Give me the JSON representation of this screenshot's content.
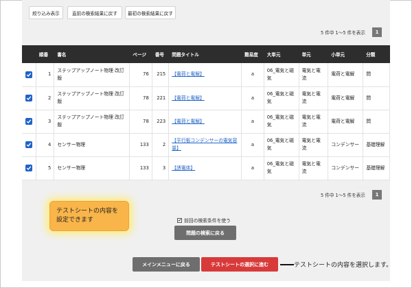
{
  "toolbar": {
    "filter_label": "絞り込み表示",
    "prev_result_label": "直前の検索結果に戻す",
    "first_result_label": "最初の検索結果に戻す"
  },
  "pager": {
    "count_text": "5 件中 1～5 件を表示",
    "current_page": "1"
  },
  "table": {
    "headers": {
      "check": "",
      "order": "順番",
      "book": "書名",
      "page": "ページ",
      "number": "番号",
      "title": "問題タイトル",
      "difficulty": "難易度",
      "major": "大単元",
      "unit": "単元",
      "minor": "小単元",
      "category": "分類"
    },
    "rows": [
      {
        "order": "1",
        "book": "ステップアップノート物理 改訂版",
        "page": "76",
        "number": "215",
        "title": "【電荷と電解】",
        "difficulty": "a",
        "major": "06_電気と磁気",
        "unit": "電気と電流",
        "minor": "電荷と電解",
        "category": "問"
      },
      {
        "order": "2",
        "book": "ステップアップノート物理 改訂版",
        "page": "78",
        "number": "221",
        "title": "【電荷と電解】",
        "difficulty": "a",
        "major": "06_電気と磁気",
        "unit": "電気と電流",
        "minor": "電荷と電解",
        "category": "問"
      },
      {
        "order": "3",
        "book": "ステップアップノート物理 改訂版",
        "page": "78",
        "number": "223",
        "title": "【電荷と電解】",
        "difficulty": "a",
        "major": "06_電気と磁気",
        "unit": "電気と電流",
        "minor": "電荷と電解",
        "category": "問"
      },
      {
        "order": "4",
        "book": "センサー物理",
        "page": "133",
        "number": "2",
        "title": "【平行板コンデンサーの電気容量】",
        "difficulty": "a",
        "major": "06_電気と磁気",
        "unit": "電気と電流",
        "minor": "コンデンサー",
        "category": "基礎理解"
      },
      {
        "order": "5",
        "book": "センサー物理",
        "page": "133",
        "number": "3",
        "title": "【誘電体】",
        "difficulty": "a",
        "major": "06_電気と磁気",
        "unit": "電気と電流",
        "minor": "コンデンサー",
        "category": "基礎理解"
      }
    ]
  },
  "tooltip": {
    "text": "テストシートの内容を設定できます"
  },
  "options": {
    "use_previous_label": "前回の検索条件を使う",
    "back_to_search_label": "問題の検索に戻る"
  },
  "footer": {
    "main_menu_label": "メインメニューに戻る",
    "next_label": "テストシートの選択に進む"
  },
  "callout": {
    "text": "テストシートの内容を選択します。"
  },
  "colors": {
    "accent_blue": "#1f63c8",
    "next_button": "#d83a3a",
    "dark_button": "#6e6e6e",
    "header_bg": "#2d2d2d",
    "tooltip_bg": "#f9b54a"
  }
}
